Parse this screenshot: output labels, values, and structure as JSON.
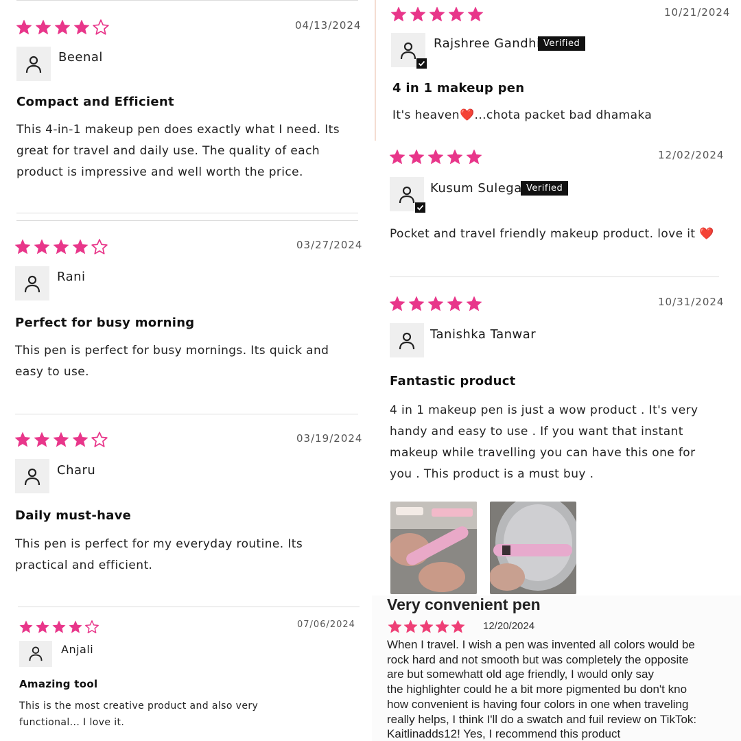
{
  "accent_color": "#e8368a",
  "reviews_left": [
    {
      "rating": 4,
      "date": "04/13/2024",
      "author": "Beenal",
      "title": "Compact and Efficient",
      "body": "This 4-in-1 makeup pen does exactly what I need. Its great for travel and daily use. The quality of each product is impressive and well worth the price."
    },
    {
      "rating": 4,
      "date": "03/27/2024",
      "author": "Rani",
      "title": "Perfect for busy morning",
      "body": "This pen is perfect for busy mornings. Its quick and easy to use."
    },
    {
      "rating": 4,
      "date": "03/19/2024",
      "author": "Charu",
      "title": "Daily must-have",
      "body": "This pen is perfect for my everyday routine. Its practical and efficient."
    },
    {
      "rating": 4,
      "date": "07/06/2024",
      "author": "Anjali",
      "title": "Amazing tool",
      "body": "This is the most creative product and also very functional... I love it."
    }
  ],
  "reviews_right": [
    {
      "rating": 5,
      "date": "10/21/2024",
      "author": "Rajshree Gandhi",
      "verified": "Verified",
      "title": "4 in 1 makeup pen",
      "body": "It's heaven❤️...chota packet bad dhamaka"
    },
    {
      "rating": 5,
      "date": "12/02/2024",
      "author": "Kusum Sulegai",
      "verified": "Verified",
      "body": "Pocket and travel friendly makeup product. love it ❤️"
    },
    {
      "rating": 5,
      "date": "10/31/2024",
      "author": "Tanishka Tanwar",
      "title": "Fantastic product",
      "body": "4 in 1 makeup pen is just a wow product . It's very handy and easy to use . If you want that instant makeup while travelling you can have this one for you . This product is a must buy ."
    }
  ],
  "bottom_review": {
    "title": "Very convenient pen",
    "rating": 5,
    "date": "12/20/2024",
    "body_lines": [
      "When I travel. I wish a pen was invented all colors would be",
      "rock hard and not smooth but was completely the opposite",
      "are but somewhatt old age friendly, I would only say",
      "the highlighter could he a bit more pigmented bu don't kno",
      "how convenient is having four colors in one when traveling",
      "really helps, I think I'll do a swatch and fuil review on TikTok:",
      "Kaitlinadds12! Yes, I recommend this product"
    ]
  }
}
